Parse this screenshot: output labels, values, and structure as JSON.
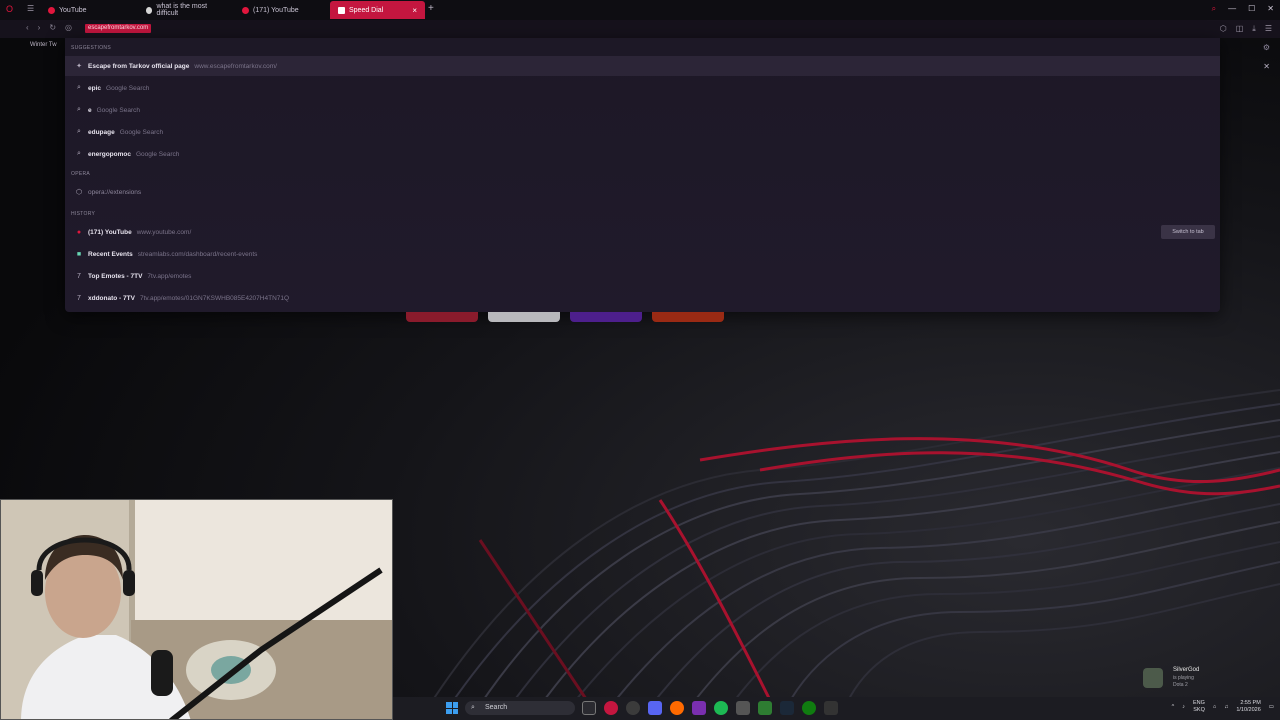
{
  "tabs": [
    {
      "label": "YouTube",
      "color": "#e1163d"
    },
    {
      "label": "what is the most difficult",
      "color": "#d6d6d6"
    },
    {
      "label": "(171) YouTube",
      "color": "#e1163d"
    },
    {
      "label": "Speed Dial",
      "color": "#ffffff"
    }
  ],
  "address_bar": {
    "value": "escapefromtarkov.com"
  },
  "bookmark": {
    "label": "Winter Tw"
  },
  "dropdown": {
    "suggestions_header": "SUGGESTIONS",
    "top_result": {
      "title": "Escape from Tarkov official page",
      "url": "www.escapefromtarkov.com/"
    },
    "searches": [
      {
        "term": "epic",
        "engine": "Google Search"
      },
      {
        "term": "e",
        "engine": "Google Search"
      },
      {
        "term": "edupage",
        "engine": "Google Search"
      },
      {
        "term": "energopomoc",
        "engine": "Google Search"
      }
    ],
    "opera_header": "OPERA",
    "opera_item": "opera://extensions",
    "history_header": "HISTORY",
    "history": [
      {
        "title": "(171) YouTube",
        "url": "www.youtube.com/"
      },
      {
        "title": "Recent Events",
        "url": "streamlabs.com/dashboard/recent-events"
      },
      {
        "title": "Top Emotes - 7TV",
        "url": "7tv.app/emotes"
      },
      {
        "title": "xddonato - 7TV",
        "url": "7tv.app/emotes/01GN7KSWHB085E4207H4TN71Q"
      }
    ],
    "switch_to_tab": "Switch to tab"
  },
  "taskbar": {
    "search_placeholder": "Search"
  },
  "notification": {
    "name": "SilverGod",
    "status": "is playing",
    "game": "Dota 2"
  },
  "tray": {
    "lang1": "ENG",
    "lang2": "SKQ",
    "time": "2:55 PM",
    "date": "1/10/2026"
  },
  "colors": {
    "accent": "#c4163f"
  }
}
